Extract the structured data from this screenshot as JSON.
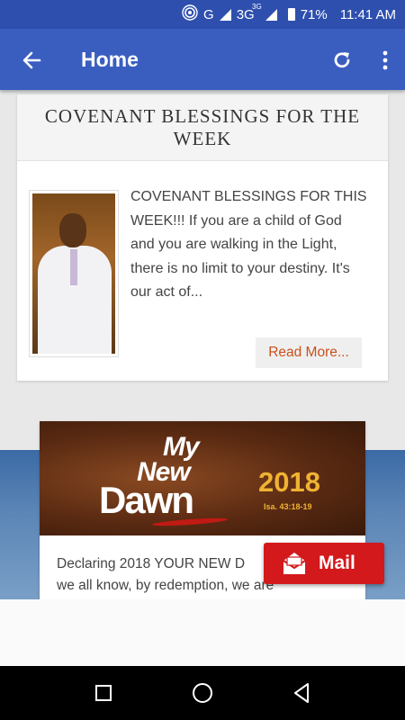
{
  "status_bar": {
    "network_type": "G",
    "network_3g": "3G",
    "network_3g_sup": "3G",
    "battery": "71%",
    "time": "11:41 AM"
  },
  "app_bar": {
    "title": "Home",
    "icons": [
      "back-arrow-icon",
      "refresh-icon",
      "overflow-menu-icon"
    ]
  },
  "post1": {
    "heading": "COVENANT BLESSINGS FOR THE WEEK",
    "excerpt": "COVENANT BLESSINGS FOR THIS WEEK!!! If you are a child of God and you are walking in the Light, there is no limit to your destiny. It's our act of...",
    "read_more": "Read More..."
  },
  "post2": {
    "banner": {
      "my": "My",
      "new": "New",
      "dawn": "Dawn",
      "year": "2018",
      "reference": "Isa. 43:18-19"
    },
    "excerpt_line1": "Declaring 2018 YOUR NEW D",
    "excerpt_line2": "we all know, by redemption, we are"
  },
  "mail_button": {
    "label": "Mail",
    "icon": "mail-icon"
  },
  "colors": {
    "status_bar": "#2e4fae",
    "app_bar": "#3a5ec0",
    "read_more_text": "#c9501c",
    "mail_button": "#d3191c"
  }
}
